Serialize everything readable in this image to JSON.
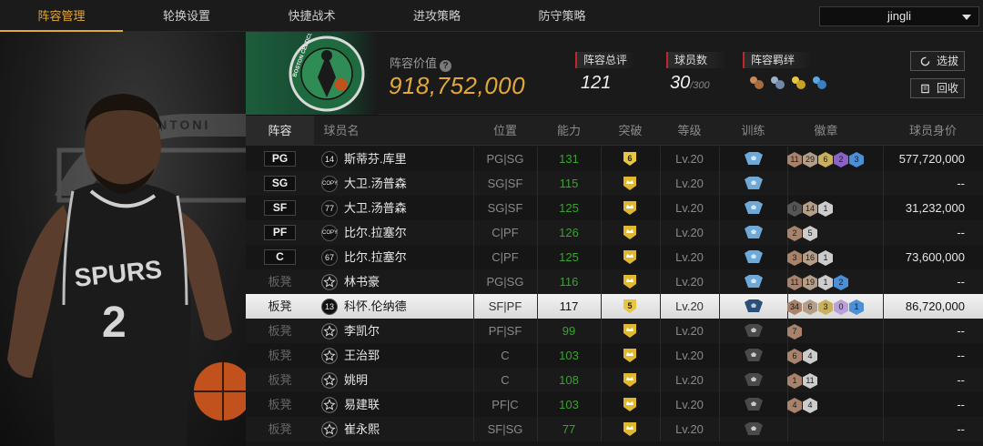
{
  "nav": {
    "tabs": [
      {
        "label": "阵容管理",
        "active": true
      },
      {
        "label": "轮换设置"
      },
      {
        "label": "快捷战术"
      },
      {
        "label": "进攻策略"
      },
      {
        "label": "防守策略"
      }
    ],
    "user": "jingli"
  },
  "left_art": {
    "jersey_text": "SPURS",
    "jersey_number": "2",
    "banner_text": "ANTONI"
  },
  "team": {
    "logo_text": "BOSTON CELTICS"
  },
  "header": {
    "value_title": "阵容价值",
    "value": "918,752,000",
    "rating_label": "阵容总评",
    "rating": "121",
    "players_label": "球员数",
    "players": "30",
    "players_max": "/300",
    "bond_label": "阵容羁绊",
    "btn_select": "选拔",
    "btn_recycle": "回收"
  },
  "columns": [
    "阵容",
    "球员名",
    "位置",
    "能力",
    "突破",
    "等级",
    "训练",
    "徽章",
    "球员身价"
  ],
  "colors": {
    "accent": "#e2a83a",
    "ability": "#3aa232",
    "stat_marker": "#c0262d"
  },
  "rows": [
    {
      "slot": "PG",
      "starter": true,
      "badge": "14",
      "name": "斯蒂芬.库里",
      "pos": "PG|SG",
      "ability": "131",
      "breakthrough": "6",
      "level": "Lv.20",
      "training": "blue",
      "badges": [
        {
          "n": "11",
          "c": "#a8826a"
        },
        {
          "n": "29",
          "c": "#b59e88"
        },
        {
          "n": "6",
          "c": "#c9b05a"
        },
        {
          "n": "2",
          "c": "#8a63c9"
        },
        {
          "n": "3",
          "c": "#4b8fd6"
        }
      ],
      "price": "577,720,000"
    },
    {
      "slot": "SG",
      "starter": true,
      "badge": "COPY",
      "name": "大卫.汤普森",
      "pos": "SG|SF",
      "ability": "115",
      "breakthrough": "",
      "level": "Lv.20",
      "training": "blue",
      "badges": [],
      "price": "--"
    },
    {
      "slot": "SF",
      "starter": true,
      "badge": "77",
      "name": "大卫.汤普森",
      "pos": "SG|SF",
      "ability": "125",
      "breakthrough": "",
      "level": "Lv.20",
      "training": "blue",
      "badges": [
        {
          "n": "0",
          "c": "#555"
        },
        {
          "n": "14",
          "c": "#b59e88"
        },
        {
          "n": "1",
          "c": "#ccc"
        }
      ],
      "price": "31,232,000"
    },
    {
      "slot": "PF",
      "starter": true,
      "badge": "COPY",
      "name": "比尔.拉塞尔",
      "pos": "C|PF",
      "ability": "126",
      "breakthrough": "",
      "level": "Lv.20",
      "training": "blue",
      "badges": [
        {
          "n": "2",
          "c": "#a8826a"
        },
        {
          "n": "5",
          "c": "#ccc"
        }
      ],
      "price": "--"
    },
    {
      "slot": "C",
      "starter": true,
      "badge": "67",
      "name": "比尔.拉塞尔",
      "pos": "C|PF",
      "ability": "125",
      "breakthrough": "",
      "level": "Lv.20",
      "training": "blue",
      "badges": [
        {
          "n": "3",
          "c": "#a8826a"
        },
        {
          "n": "16",
          "c": "#b59e88"
        },
        {
          "n": "1",
          "c": "#ccc"
        }
      ],
      "price": "73,600,000"
    },
    {
      "slot": "板凳",
      "starter": false,
      "badge": "star",
      "name": "林书豪",
      "pos": "PG|SG",
      "ability": "116",
      "breakthrough": "",
      "level": "Lv.20",
      "training": "blue",
      "badges": [
        {
          "n": "11",
          "c": "#a8826a"
        },
        {
          "n": "19",
          "c": "#b59e88"
        },
        {
          "n": "1",
          "c": "#ccc"
        },
        {
          "n": "2",
          "c": "#4b8fd6"
        }
      ],
      "price": "--"
    },
    {
      "slot": "板凳",
      "starter": false,
      "selected": true,
      "badge": "13",
      "name": "科怀.伦纳德",
      "pos": "SF|PF",
      "ability": "117",
      "breakthrough": "5",
      "level": "Lv.20",
      "training": "dark",
      "badges": [
        {
          "n": "34",
          "c": "#a8826a"
        },
        {
          "n": "6",
          "c": "#b59e88"
        },
        {
          "n": "3",
          "c": "#c9b05a"
        },
        {
          "n": "0",
          "c": "#b8a0d8"
        },
        {
          "n": "1",
          "c": "#4b8fd6"
        }
      ],
      "price": "86,720,000"
    },
    {
      "slot": "板凳",
      "starter": false,
      "badge": "star",
      "name": "李凯尔",
      "pos": "PF|SF",
      "ability": "99",
      "breakthrough": "",
      "level": "Lv.20",
      "training": "gray",
      "badges": [
        {
          "n": "7",
          "c": "#a8826a"
        }
      ],
      "price": "--"
    },
    {
      "slot": "板凳",
      "starter": false,
      "badge": "star",
      "name": "王治郅",
      "pos": "C",
      "ability": "103",
      "breakthrough": "",
      "level": "Lv.20",
      "training": "gray",
      "badges": [
        {
          "n": "6",
          "c": "#a8826a"
        },
        {
          "n": "4",
          "c": "#ccc"
        }
      ],
      "price": "--"
    },
    {
      "slot": "板凳",
      "starter": false,
      "badge": "star",
      "name": "姚明",
      "pos": "C",
      "ability": "108",
      "breakthrough": "",
      "level": "Lv.20",
      "training": "gray",
      "badges": [
        {
          "n": "1",
          "c": "#a8826a"
        },
        {
          "n": "11",
          "c": "#ccc"
        }
      ],
      "price": "--"
    },
    {
      "slot": "板凳",
      "starter": false,
      "badge": "star",
      "name": "易建联",
      "pos": "PF|C",
      "ability": "103",
      "breakthrough": "",
      "level": "Lv.20",
      "training": "gray",
      "badges": [
        {
          "n": "4",
          "c": "#a8826a"
        },
        {
          "n": "4",
          "c": "#ccc"
        }
      ],
      "price": "--"
    },
    {
      "slot": "板凳",
      "starter": false,
      "badge": "star",
      "name": "崔永熙",
      "pos": "SF|SG",
      "ability": "77",
      "breakthrough": "",
      "level": "Lv.20",
      "training": "gray",
      "badges": [],
      "price": "--"
    }
  ]
}
